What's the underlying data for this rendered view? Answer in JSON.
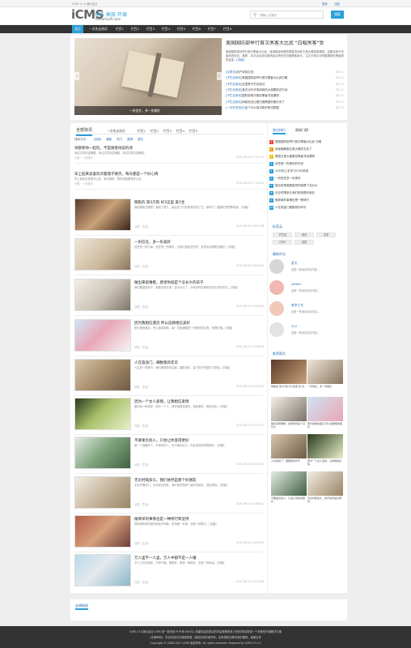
{
  "topbar": {
    "title": "iCMS v7.0 演示站点",
    "login": "登录",
    "register": "注册"
  },
  "header": {
    "logo": "iCMS",
    "slogan": "简洁 高效 开源",
    "domain": "idreamsoft.com",
    "search_placeholder": "请输入关键字",
    "search_button": "搜索"
  },
  "nav": [
    "首页",
    "一次失去测试",
    "栏目1",
    "栏目2",
    "栏目3",
    "栏目4",
    "栏目5",
    "栏目6",
    "栏目7",
    "栏目8"
  ],
  "slider": {
    "caption": "一份信任，多一份美好"
  },
  "headline": {
    "title": "美国国防部举行首次黑客大比武 \"白帽黑客\"受",
    "summary": "美国国防部将举行首次黑客大比武，邀请数量有限的黑客寻找其五角大楼网络漏洞。结果将用于改善系统安全。据悉，本次活动将仅邀请经过审查的白帽黑客参与，主办方表示对挖掘漏洞的黑客提供奖金...",
    "more": "[详细]",
    "related": [
      {
        "tag": "[文章页]",
        "title": "用户体验交流",
        "date": "03-11"
      },
      {
        "tag": "[子栏目测试]",
        "title": "美国国防部举行首次黑客大比武白帽",
        "date": "03-11"
      },
      {
        "tag": "[子栏目测试]",
        "title": "这里是子栏目测试",
        "date": "03-11"
      },
      {
        "tag": "[子栏目测试]",
        "title": "首次对外开放网络的大规模测试行动",
        "date": "03-11"
      },
      {
        "tag": "[子栏目测试]",
        "title": "国防部首次悬赏黑客寻找漏洞",
        "date": "03-11"
      },
      {
        "tag": "[子栏目测试]",
        "title": "网络安全比赛白帽黑客的春天来了",
        "date": "03-11"
      },
      {
        "tag": "[一次失去测试]",
        "title": "这个月么测试新的测试数据",
        "date": "03-11"
      }
    ]
  },
  "tabs": [
    "全部资讯",
    "一次失去测试",
    "栏目1",
    "栏目2",
    "栏目3",
    "栏目4",
    "栏目5"
  ],
  "filter": {
    "label": "排序方式：",
    "items": [
      "[全部]",
      "最新",
      "热门",
      "推荐",
      "图文"
    ]
  },
  "articles": [
    {
      "title": "诗歌和你一起吃，不是随意地说的诗",
      "desc": "测试文章内容摘要，测试文章内容摘要，测试文章内容摘要。",
      "meta": "分类：一次测试",
      "time": "2017-06-15 17:17:12"
    },
    {
      "title": "早上起来总喜欢对着镜子微笑，每天都是一个好心情",
      "desc": "早上起来总是很开心的，每天都是，愿你也能拥有好心情。",
      "meta": "分类：一次测试",
      "time": "2017-06-15 17:15:02"
    },
    {
      "title": "钥匙的 第3只狗 好2这里 爱1生",
      "desc": "我的钥匙在哪里？我找了很久，最后在门口的角落发现了它，原来它一直都在那里等着我。[详细]",
      "meta": "分类：栏目1",
      "time": "2017-06-15 16:57:08"
    },
    {
      "title": "一份信任，多一份美好",
      "desc": "信任是一种力量，信任是一份美好，当我们彼此信任时，世界会变得更加美好。[详细]",
      "meta": "分类：栏目1",
      "time": "2017-06-15 16:32:44"
    },
    {
      "title": "做出来很难看，感觉你就是个没长大的孩子",
      "desc": "我们都曾是孩子，都曾天真无邪，如今长大了，却依然怀念那段无忧无虑的时光。[详细]",
      "meta": "分类：栏目1",
      "time": "2017-06-15 15:58:33"
    },
    {
      "title": "因为我相信遇见 所以选择相信美好",
      "desc": "因为相信遇见，所以选择相信。每一次相遇都是一份美好的礼物，值得珍惜。[详细]",
      "meta": "分类：栏目1",
      "time": "2017-06-15 15:46:15"
    },
    {
      "title": "人在旅途门，细数我的年华",
      "desc": "人生是一场旅行，我们都是匆匆过客，细数流年，留下的只有回忆与感动。[详细]",
      "meta": "分类：栏目1",
      "time": "2017-06-15 15:36:02"
    },
    {
      "title": "因为一个女人爱我，让我相信爱情",
      "desc": "爱情是一种信仰，因为一个人，我开始相信爱情，相信美好，相信未来。[详细]",
      "meta": "分类：栏目1",
      "time": "2017-06-15 15:21:47"
    },
    {
      "title": "不要辜负别人，只会让你变得更好",
      "desc": "做一个温暖的人，不辜负别人，也不辜负自己，你会发现世界很美好。[详细]",
      "meta": "分类：栏目1",
      "time": "2017-06-15 15:11:10"
    },
    {
      "title": "无论时隔多久，我们依然是那个好朋友",
      "desc": "无论时隔多久，无论身在何处，我们依然是那个最好的朋友，彼此牵挂。[详细]",
      "meta": "分类：栏目1",
      "time": "2017-06-15 14:58:21"
    },
    {
      "title": "做简单的事情也是一种修行和坚持",
      "desc": "把简单的事情做好就是不简单，坚持做一件事，也是一种修行。[详细]",
      "meta": "分类：栏目1",
      "time": "2017-06-15 14:49:39"
    },
    {
      "title": "万人里不一人里，万人中都不是一人懂",
      "desc": "万人之中找到你，不早不晚，刚刚好，那是一种缘分，也是一种幸运。[详细]",
      "meta": "分类：栏目1",
      "time": "2017-06-15 14:32:06"
    }
  ],
  "friend_links_label": "友情链接",
  "sidebar": {
    "hot_tabs": [
      "热点排行",
      "周热门榜"
    ],
    "hot": [
      "美国国防部举行首次黑客大比武 白帽",
      "我读懂美国五角大楼的文化了",
      "美国五角大楼悬赏黑客寻找漏洞",
      "信任是一份美好的东西",
      "10分钟上手学习iCMS系统",
      "一份信任多一份美好",
      "做出来很难看感觉你就是个没长大",
      "无论时隔多久我们依然是好朋友",
      "做简单的事情也是一种修行",
      "人在旅途门细数我的年华"
    ],
    "tags_title": "标签云",
    "tags": [
      "子栏目",
      "测试",
      "文章",
      "iCMS",
      "信任"
    ],
    "comments_title": "最新评论",
    "comments": [
      {
        "name": "夏天",
        "text": "这是一条测试评论内容..."
      },
      {
        "name": "sdfdfd",
        "text": "这是一条测试评论内容..."
      },
      {
        "name": "老李工社",
        "text": "这是一条测试评论内容..."
      },
      {
        "name": "522",
        "text": "这是一条测试评论内容..."
      }
    ],
    "pics_title": "推荐图文",
    "pics": [
      {
        "cap": "钥匙的 第3只狗 好2这里 爱1生"
      },
      {
        "cap": "一份信任，多一份美好"
      },
      {
        "cap": "做出来很难看，感觉你就是个没长大"
      },
      {
        "cap": "因为我相信遇见 所以选择相信美好"
      },
      {
        "cap": "人在旅途门，细数我的年华"
      },
      {
        "cap": "因为一个女人爱我，让我相信爱情"
      },
      {
        "cap": "不要辜负别人，只会让你变得更好"
      },
      {
        "cap": "无论时隔多久，我们依然是好朋友"
      }
    ]
  },
  "footer": {
    "line1": "iCMS v7.0演示站点 iCMS 是一套采用 PHP 和 MySQL 构建的高效简洁的内容管理系统,为您的网站提供一个完美的开源解决方案",
    "line2": "(法律声明)：本站内容均为网络转载，版权归原作者所有，如有侵权请联系我们删除，谢谢合作",
    "line3": "Copyright © 2008-2017 iCMS 版权所有. All rights reserved. Powered by iCMS V7.0.2"
  },
  "colors": {
    "accent": "#2b9fd8",
    "nav_bg": "#333333",
    "footer_bg": "#333333"
  }
}
